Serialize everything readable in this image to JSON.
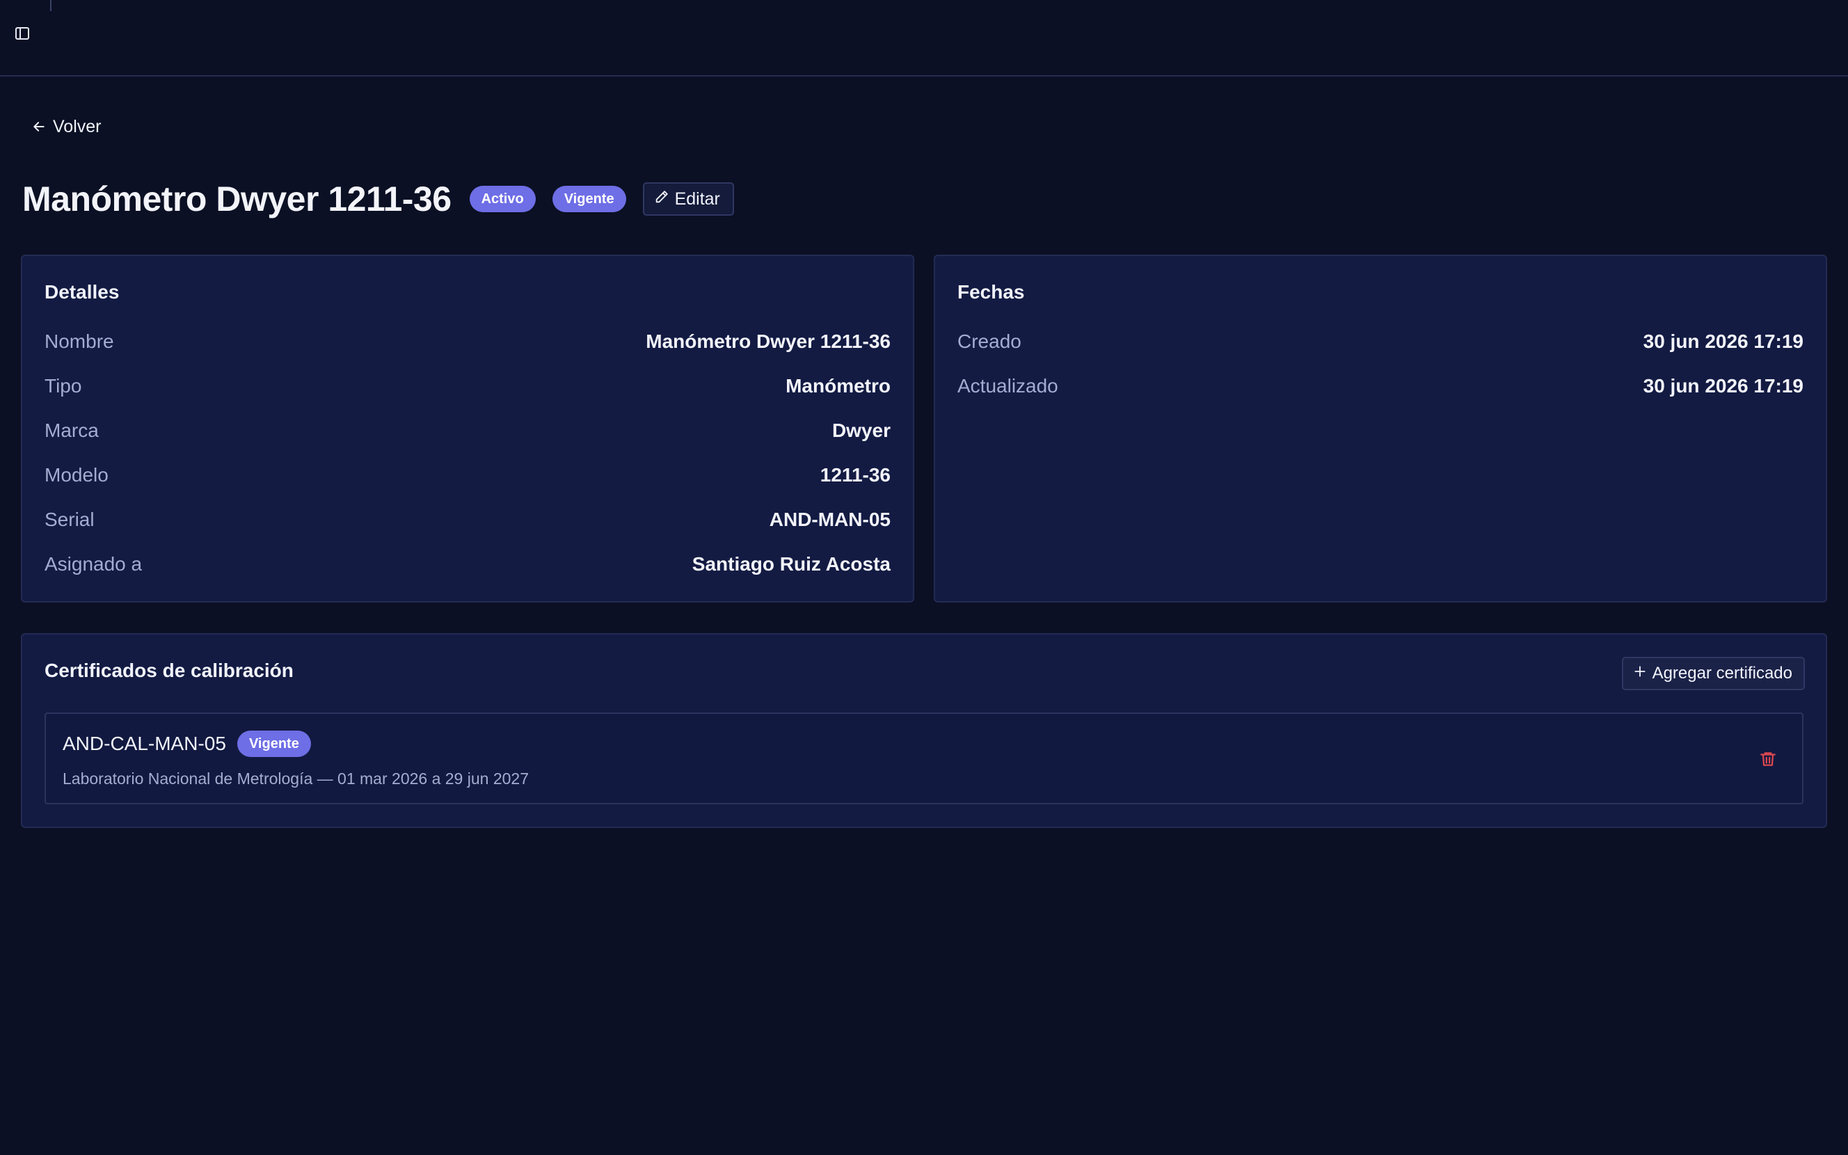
{
  "nav": {
    "sidebar_toggle_icon": "sidebar-panel-icon",
    "back_label": "Volver",
    "back_icon": "arrow-left-icon"
  },
  "header": {
    "title": "Manómetro Dwyer 1211-36",
    "status_badge": "Activo",
    "validity_badge": "Vigente",
    "edit_label": "Editar",
    "edit_icon": "pencil-icon"
  },
  "details": {
    "title": "Detalles",
    "rows": [
      {
        "label": "Nombre",
        "value": "Manómetro Dwyer 1211-36"
      },
      {
        "label": "Tipo",
        "value": "Manómetro"
      },
      {
        "label": "Marca",
        "value": "Dwyer"
      },
      {
        "label": "Modelo",
        "value": "1211-36"
      },
      {
        "label": "Serial",
        "value": "AND-MAN-05"
      },
      {
        "label": "Asignado a",
        "value": "Santiago Ruiz Acosta"
      }
    ]
  },
  "dates": {
    "title": "Fechas",
    "rows": [
      {
        "label": "Creado",
        "value": "30 jun 2026 17:19"
      },
      {
        "label": "Actualizado",
        "value": "30 jun 2026 17:19"
      }
    ]
  },
  "certificates": {
    "title": "Certificados de calibración",
    "add_label": "Agregar certificado",
    "add_icon": "plus-icon",
    "items": [
      {
        "code": "AND-CAL-MAN-05",
        "badge": "Vigente",
        "meta": "Laboratorio Nacional de Metrología — 01 mar 2026 a 29 jun 2027",
        "delete_icon": "trash-icon"
      }
    ]
  },
  "colors": {
    "background": "#0b1024",
    "card": "#131b43",
    "badge": "#6e6ee6",
    "danger": "#e0484f",
    "muted_text": "#a5acd0"
  }
}
